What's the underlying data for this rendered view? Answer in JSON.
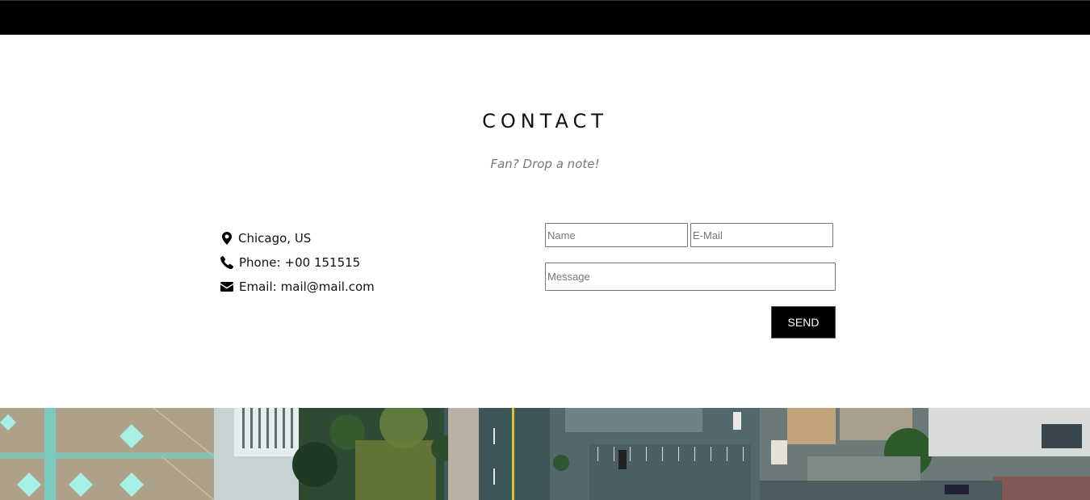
{
  "header": {
    "title": "CONTACT",
    "subtitle": "Fan? Drop a note!"
  },
  "contact_info": {
    "location": "Chicago, US",
    "phone_label": "Phone:",
    "phone": "+00 151515",
    "email_label": "Email:",
    "email": "mail@mail.com"
  },
  "form": {
    "name_placeholder": "Name",
    "email_placeholder": "E-Mail",
    "message_placeholder": "Message",
    "send_label": "SEND"
  },
  "icons": {
    "location": "map-marker-icon",
    "phone": "phone-icon",
    "email": "envelope-icon"
  },
  "colors": {
    "topbar": "#000000",
    "button": "#000000",
    "subtitle": "#777777"
  }
}
